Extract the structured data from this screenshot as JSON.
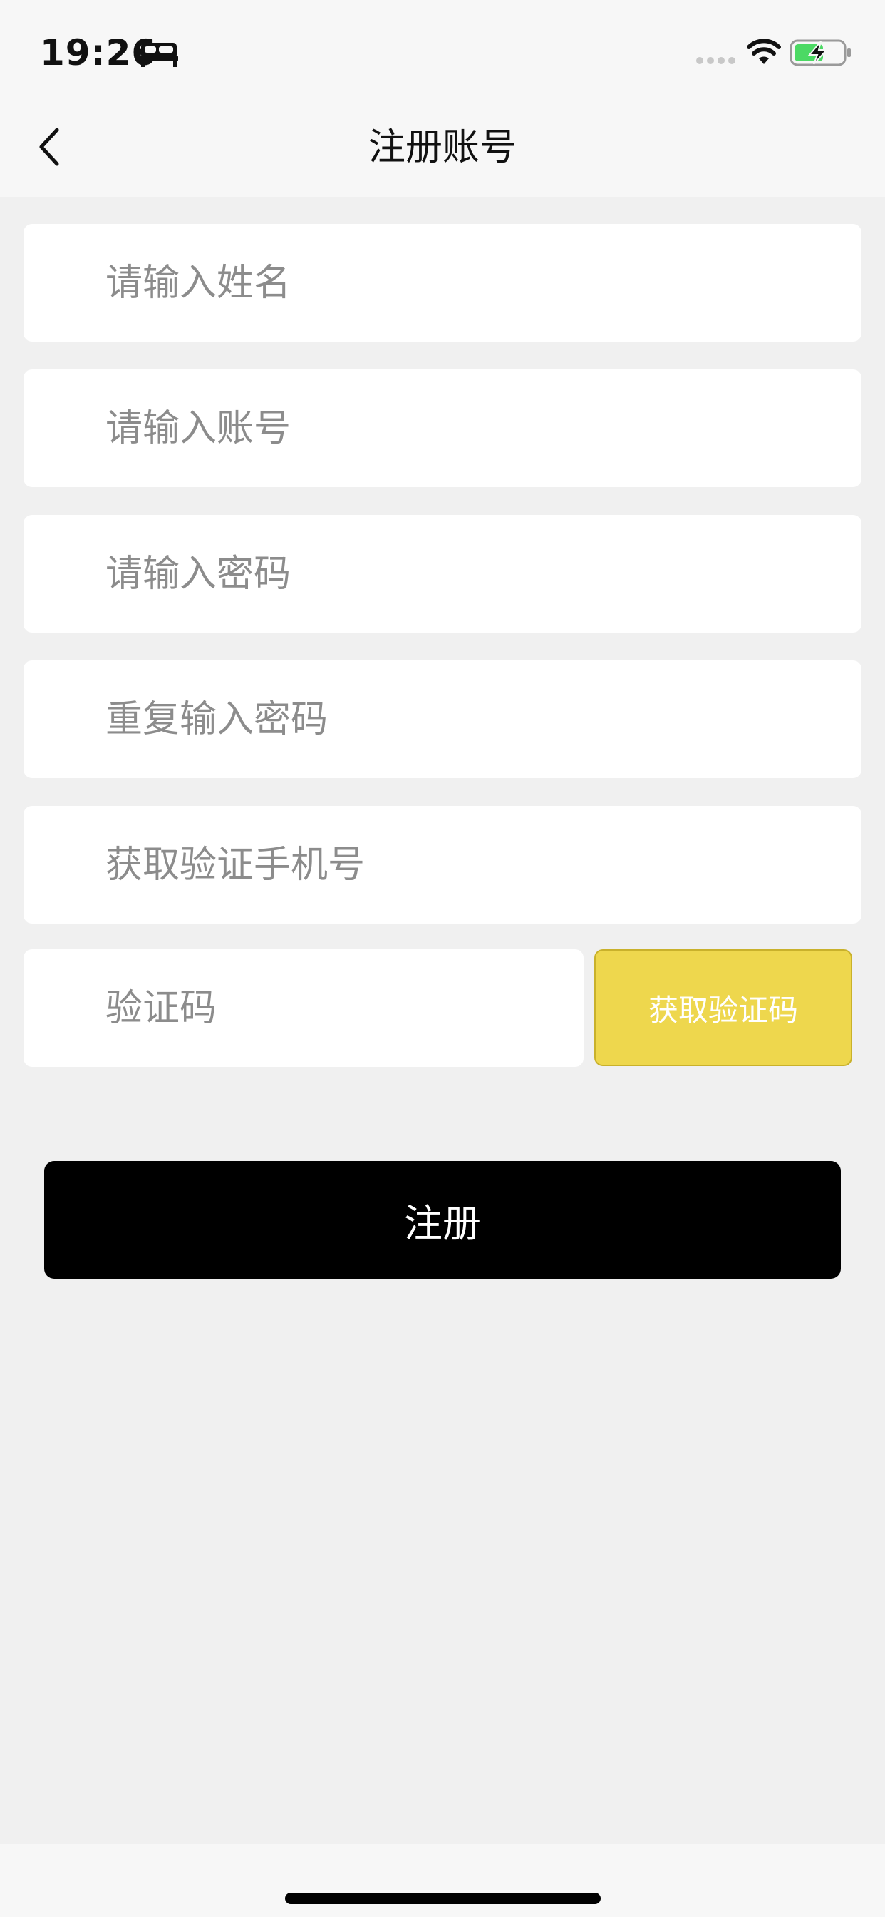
{
  "status_bar": {
    "time": "19:26",
    "icons": [
      "bed-icon",
      "signal-icon",
      "wifi-icon",
      "battery-charging-icon"
    ]
  },
  "nav": {
    "title": "注册账号",
    "back_icon": "chevron-left-icon"
  },
  "form": {
    "name_placeholder": "请输入姓名",
    "account_placeholder": "请输入账号",
    "password_placeholder": "请输入密码",
    "repeat_password_placeholder": "重复输入密码",
    "phone_placeholder": "获取验证手机号",
    "code_placeholder": "验证码",
    "get_code_label": "获取验证码",
    "submit_label": "注册"
  },
  "colors": {
    "background": "#f0f0f0",
    "field": "#ffffff",
    "accent_button": "#eed74d",
    "primary_button": "#000000",
    "placeholder": "#8c8c8c"
  }
}
